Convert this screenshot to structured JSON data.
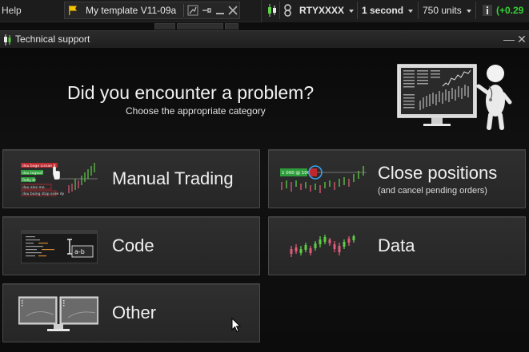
{
  "topbar": {
    "help_label": "Help",
    "template_name": "My template V11-09a",
    "instrument": "RTYXXXX",
    "timeframe": "1 second",
    "quantity": "750 units",
    "change": "(+0.29",
    "colors": {
      "positive": "#35d235",
      "flag": "#f5c400"
    }
  },
  "dialog": {
    "title": "Technical support",
    "question": "Did you encounter a problem?",
    "subtitle": "Choose the appropriate category",
    "categories": [
      {
        "label": "Manual Trading",
        "sublabel": ""
      },
      {
        "label": "Close positions",
        "sublabel": "(and cancel pending orders)"
      },
      {
        "label": "Code",
        "sublabel": ""
      },
      {
        "label": "Data",
        "sublabel": ""
      },
      {
        "label": "Other",
        "sublabel": ""
      }
    ],
    "manual_trading_thumb": {
      "labels": [
        "dou bage Lisnae fr",
        "dou togwaf",
        "Rally bt",
        "dau ales me",
        "do Laalingrant ssee",
        "dou baing stop ssee dy"
      ]
    },
    "close_positions_thumb": {
      "label": "1 000 @ 100.3"
    },
    "code_thumb": {
      "label": "a-b"
    }
  }
}
